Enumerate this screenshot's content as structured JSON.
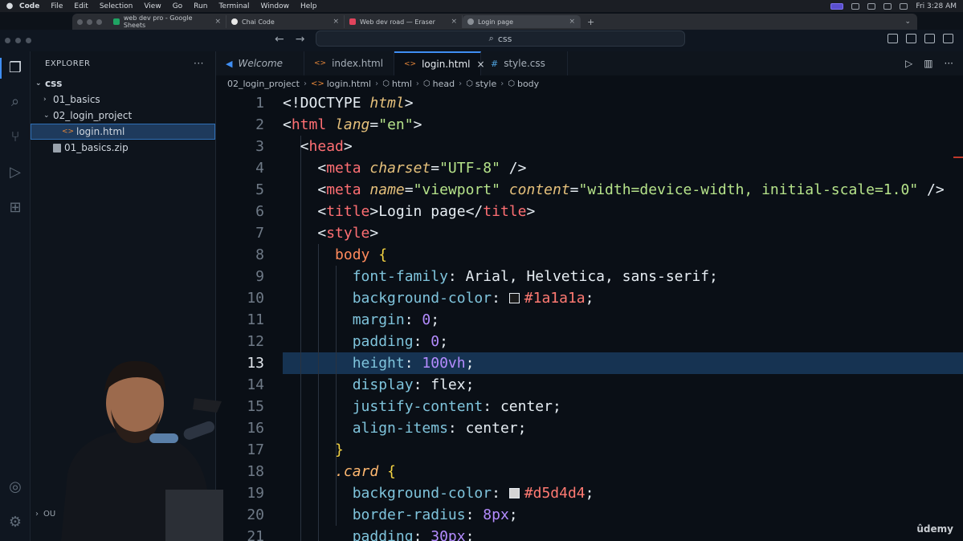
{
  "menubar": {
    "items": [
      "Code",
      "File",
      "Edit",
      "Selection",
      "View",
      "Go",
      "Run",
      "Terminal",
      "Window",
      "Help"
    ],
    "clock": "Fri 3:28 AM"
  },
  "browser": {
    "tabs": [
      {
        "label": "web dev pro - Google Sheets",
        "color": "#1fa463"
      },
      {
        "label": "Chai Code",
        "color": "#e8e8e8"
      },
      {
        "label": "Web dev road — Eraser",
        "color": "#e2445c"
      },
      {
        "label": "Login page",
        "color": "#8a8f96"
      }
    ]
  },
  "titlebar": {
    "search": "css"
  },
  "sidebar": {
    "title": "EXPLORER",
    "more": "···",
    "items": [
      {
        "label": "css",
        "indent": 0,
        "kind": "root",
        "chev": "⌄"
      },
      {
        "label": "01_basics",
        "indent": 1,
        "kind": "folder",
        "chev": "›"
      },
      {
        "label": "02_login_project",
        "indent": 1,
        "kind": "folder",
        "chev": "⌄"
      },
      {
        "label": "login.html",
        "indent": 2,
        "kind": "html",
        "chev": ""
      },
      {
        "label": "01_basics.zip",
        "indent": 1,
        "kind": "zip",
        "chev": ""
      }
    ],
    "outline": "OU"
  },
  "editor_tabs": [
    {
      "label": "Welcome",
      "icon": "vscode",
      "active": false
    },
    {
      "label": "index.html",
      "icon": "html",
      "active": false
    },
    {
      "label": "login.html",
      "icon": "html",
      "active": true
    },
    {
      "label": "style.css",
      "icon": "css",
      "active": false
    }
  ],
  "breadcrumb": [
    "02_login_project",
    "login.html",
    "html",
    "head",
    "style",
    "body"
  ],
  "code": {
    "current_line": 13,
    "line_numbers": [
      "1",
      "2",
      "3",
      "4",
      "5",
      "6",
      "7",
      "8",
      "9",
      "10",
      "11",
      "12",
      "13",
      "14",
      "15",
      "16",
      "17",
      "18",
      "19",
      "20",
      "21"
    ],
    "lines": [
      [
        {
          "t": "<!DOCTYPE ",
          "c": "kw"
        },
        {
          "t": "html",
          "c": "attr"
        },
        {
          "t": ">",
          "c": "kw"
        }
      ],
      [
        {
          "t": "<",
          "c": "kw"
        },
        {
          "t": "html",
          "c": "tag"
        },
        {
          "t": " ",
          "c": "kw"
        },
        {
          "t": "lang",
          "c": "attr"
        },
        {
          "t": "=",
          "c": "kw"
        },
        {
          "t": "\"en\"",
          "c": "str"
        },
        {
          "t": ">",
          "c": "kw"
        }
      ],
      [
        {
          "t": "  <",
          "c": "kw"
        },
        {
          "t": "head",
          "c": "tag"
        },
        {
          "t": ">",
          "c": "kw"
        }
      ],
      [
        {
          "t": "    <",
          "c": "kw"
        },
        {
          "t": "meta",
          "c": "tag"
        },
        {
          "t": " ",
          "c": "kw"
        },
        {
          "t": "charset",
          "c": "attr"
        },
        {
          "t": "=",
          "c": "kw"
        },
        {
          "t": "\"UTF-8\"",
          "c": "str"
        },
        {
          "t": " />",
          "c": "kw"
        }
      ],
      [
        {
          "t": "    <",
          "c": "kw"
        },
        {
          "t": "meta",
          "c": "tag"
        },
        {
          "t": " ",
          "c": "kw"
        },
        {
          "t": "name",
          "c": "attr"
        },
        {
          "t": "=",
          "c": "kw"
        },
        {
          "t": "\"viewport\"",
          "c": "str"
        },
        {
          "t": " ",
          "c": "kw"
        },
        {
          "t": "content",
          "c": "attr"
        },
        {
          "t": "=",
          "c": "kw"
        },
        {
          "t": "\"width=device-width, initial-scale=1.0\"",
          "c": "str"
        },
        {
          "t": " />",
          "c": "kw"
        }
      ],
      [
        {
          "t": "    <",
          "c": "kw"
        },
        {
          "t": "title",
          "c": "tag"
        },
        {
          "t": ">Login page</",
          "c": "kw"
        },
        {
          "t": "title",
          "c": "tag"
        },
        {
          "t": ">",
          "c": "kw"
        }
      ],
      [
        {
          "t": "    <",
          "c": "kw"
        },
        {
          "t": "style",
          "c": "tag"
        },
        {
          "t": ">",
          "c": "kw"
        }
      ],
      [
        {
          "t": "      ",
          "c": "kw"
        },
        {
          "t": "body",
          "c": "sel"
        },
        {
          "t": " ",
          "c": "kw"
        },
        {
          "t": "{",
          "c": "brace"
        }
      ],
      [
        {
          "t": "        ",
          "c": "kw"
        },
        {
          "t": "font-family",
          "c": "prop"
        },
        {
          "t": ": Arial, Helvetica, sans-serif;",
          "c": "kw"
        }
      ],
      [
        {
          "t": "        ",
          "c": "kw"
        },
        {
          "t": "background-color",
          "c": "prop"
        },
        {
          "t": ": ",
          "c": "kw"
        },
        {
          "t": "",
          "c": "swatch",
          "color": "#1a1a1a"
        },
        {
          "t": "#1a1a1a",
          "c": "hex"
        },
        {
          "t": ";",
          "c": "kw"
        }
      ],
      [
        {
          "t": "        ",
          "c": "kw"
        },
        {
          "t": "margin",
          "c": "prop"
        },
        {
          "t": ": ",
          "c": "kw"
        },
        {
          "t": "0",
          "c": "num"
        },
        {
          "t": ";",
          "c": "kw"
        }
      ],
      [
        {
          "t": "        ",
          "c": "kw"
        },
        {
          "t": "padding",
          "c": "prop"
        },
        {
          "t": ": ",
          "c": "kw"
        },
        {
          "t": "0",
          "c": "num"
        },
        {
          "t": ";",
          "c": "kw"
        }
      ],
      [
        {
          "t": "        ",
          "c": "kw"
        },
        {
          "t": "height",
          "c": "prop"
        },
        {
          "t": ": ",
          "c": "kw"
        },
        {
          "t": "100vh",
          "c": "num"
        },
        {
          "t": ";",
          "c": "kw"
        }
      ],
      [
        {
          "t": "        ",
          "c": "kw"
        },
        {
          "t": "display",
          "c": "prop"
        },
        {
          "t": ": flex;",
          "c": "kw"
        }
      ],
      [
        {
          "t": "        ",
          "c": "kw"
        },
        {
          "t": "justify-content",
          "c": "prop"
        },
        {
          "t": ": center;",
          "c": "kw"
        }
      ],
      [
        {
          "t": "        ",
          "c": "kw"
        },
        {
          "t": "align-items",
          "c": "prop"
        },
        {
          "t": ": center;",
          "c": "kw"
        }
      ],
      [
        {
          "t": "      ",
          "c": "kw"
        },
        {
          "t": "}",
          "c": "brace"
        }
      ],
      [
        {
          "t": "      ",
          "c": "kw"
        },
        {
          "t": ".card",
          "c": "cls"
        },
        {
          "t": " ",
          "c": "kw"
        },
        {
          "t": "{",
          "c": "brace"
        }
      ],
      [
        {
          "t": "        ",
          "c": "kw"
        },
        {
          "t": "background-color",
          "c": "prop"
        },
        {
          "t": ": ",
          "c": "kw"
        },
        {
          "t": "",
          "c": "swatch",
          "color": "#d5d4d4"
        },
        {
          "t": "#d5d4d4",
          "c": "hex"
        },
        {
          "t": ";",
          "c": "kw"
        }
      ],
      [
        {
          "t": "        ",
          "c": "kw"
        },
        {
          "t": "border-radius",
          "c": "prop"
        },
        {
          "t": ": ",
          "c": "kw"
        },
        {
          "t": "8px",
          "c": "num"
        },
        {
          "t": ";",
          "c": "kw"
        }
      ],
      [
        {
          "t": "        ",
          "c": "kw"
        },
        {
          "t": "padding",
          "c": "prop"
        },
        {
          "t": ": ",
          "c": "kw"
        },
        {
          "t": "30px",
          "c": "num"
        },
        {
          "t": ";",
          "c": "kw"
        }
      ]
    ]
  },
  "watermark": "ûdemy"
}
